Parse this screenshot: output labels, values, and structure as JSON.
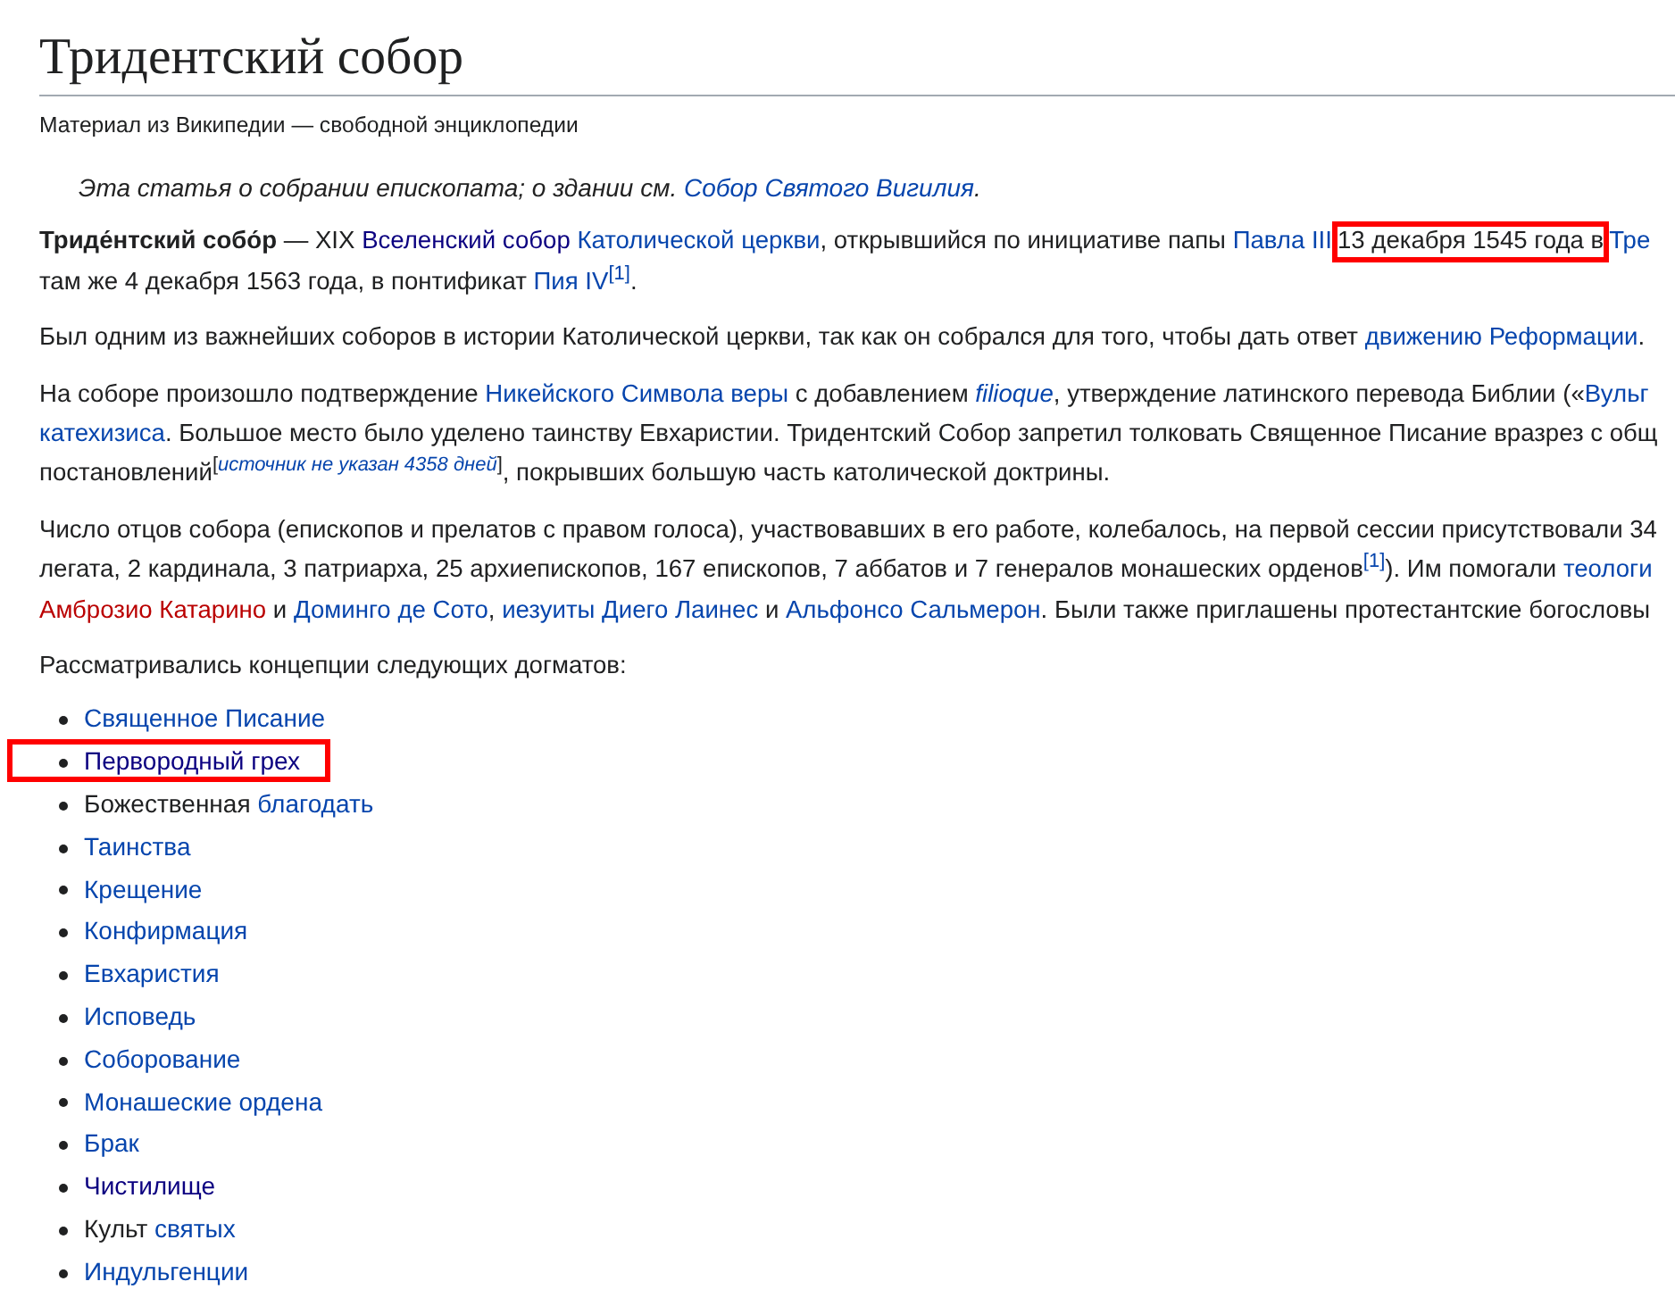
{
  "title": "Тридентский собор",
  "subtitle": "Материал из Википедии — свободной энциклопедии",
  "hatnote": [
    {
      "kind": "text",
      "text": "Эта статья о собрании епископата; о здании см. "
    },
    {
      "kind": "link",
      "text": "Собор Святого Вигилия"
    },
    {
      "kind": "text",
      "text": "."
    }
  ],
  "paragraphs": [
    {
      "lines": [
        [
          {
            "kind": "bold",
            "text": "Триде́нтский собо́р"
          },
          {
            "kind": "text",
            "text": " — XIX "
          },
          {
            "kind": "visited",
            "text": "Вселенский собор "
          },
          {
            "kind": "link",
            "text": "Католической церкви"
          },
          {
            "kind": "text",
            "text": ", открывшийся по инициативе папы "
          },
          {
            "kind": "link",
            "text": "Павла III"
          },
          {
            "kind": "text",
            "text": " 13 декабря 1545 года в ",
            "highlighted": true
          },
          {
            "kind": "link",
            "text": "Тре"
          }
        ],
        [
          {
            "kind": "text",
            "text": "там же 4 декабря 1563 года, в понтификат "
          },
          {
            "kind": "link",
            "text": "Пия IV"
          },
          {
            "kind": "sup",
            "parts": [
              {
                "kind": "link",
                "text": "[1]"
              }
            ]
          },
          {
            "kind": "text",
            "text": "."
          }
        ]
      ]
    },
    {
      "lines": [
        [
          {
            "kind": "text",
            "text": "Был одним из важнейших соборов в истории Католической церкви, так как он собрался для того, чтобы дать ответ "
          },
          {
            "kind": "link",
            "text": "движению Реформации"
          },
          {
            "kind": "text",
            "text": "."
          }
        ]
      ]
    },
    {
      "lines": [
        [
          {
            "kind": "text",
            "text": "На соборе произошло подтверждение "
          },
          {
            "kind": "link",
            "text": "Никейского Символа веры"
          },
          {
            "kind": "text",
            "text": " с добавлением "
          },
          {
            "kind": "italic_link",
            "text": "filioque"
          },
          {
            "kind": "text",
            "text": ", утверждение латинского перевода Библии («"
          },
          {
            "kind": "link",
            "text": "Вульг"
          }
        ],
        [
          {
            "kind": "link",
            "text": "катехизиса"
          },
          {
            "kind": "text",
            "text": ". Большое место было уделено таинству Евхаристии. Тридентский Собор запретил толковать Священное Писание вразрез с общ"
          }
        ],
        [
          {
            "kind": "text",
            "text": "постановлений"
          },
          {
            "kind": "sup",
            "parts": [
              {
                "kind": "text",
                "text": "["
              },
              {
                "kind": "italic_link",
                "text": "источник не указан 4358 дней"
              },
              {
                "kind": "text",
                "text": "]"
              }
            ]
          },
          {
            "kind": "text",
            "text": ", покрывших большую часть католической доктрины."
          }
        ]
      ]
    },
    {
      "lines": [
        [
          {
            "kind": "text",
            "text": "Число отцов собора (епископов и прелатов с правом голоса), участвовавших в его работе, колебалось, на первой сессии присутствовали 34"
          }
        ],
        [
          {
            "kind": "text",
            "text": "легата, 2 кардинала, 3 патриарха, 25 архиепископов, 167 епископов, 7 аббатов и 7 генералов монашеских орденов"
          },
          {
            "kind": "sup",
            "parts": [
              {
                "kind": "link",
                "text": "[1]"
              }
            ]
          },
          {
            "kind": "text",
            "text": "). Им помогали "
          },
          {
            "kind": "link",
            "text": "теологи"
          }
        ],
        [
          {
            "kind": "new",
            "text": "Амброзио Катарино"
          },
          {
            "kind": "text",
            "text": " и "
          },
          {
            "kind": "link",
            "text": "Доминго де Сото"
          },
          {
            "kind": "text",
            "text": ", "
          },
          {
            "kind": "link",
            "text": "иезуиты Диего Лаинес"
          },
          {
            "kind": "text",
            "text": " и "
          },
          {
            "kind": "link",
            "text": "Альфонсо Сальмерон"
          },
          {
            "kind": "text",
            "text": ". Были также приглашены протестантские богословы"
          }
        ]
      ]
    },
    {
      "lines": [
        [
          {
            "kind": "text",
            "text": "Рассматривались концепции следующих догматов:"
          }
        ]
      ]
    }
  ],
  "list": [
    {
      "highlighted": false,
      "parts": [
        {
          "kind": "link",
          "text": "Священное Писание"
        }
      ]
    },
    {
      "highlighted": true,
      "parts": [
        {
          "kind": "visited",
          "text": "Первородный грех"
        }
      ]
    },
    {
      "highlighted": false,
      "parts": [
        {
          "kind": "text",
          "text": "Божественная "
        },
        {
          "kind": "link",
          "text": "благодать"
        }
      ]
    },
    {
      "highlighted": false,
      "parts": [
        {
          "kind": "link",
          "text": "Таинства"
        }
      ]
    },
    {
      "highlighted": false,
      "parts": [
        {
          "kind": "link",
          "text": "Крещение"
        }
      ]
    },
    {
      "highlighted": false,
      "parts": [
        {
          "kind": "link",
          "text": "Конфирмация"
        }
      ]
    },
    {
      "highlighted": false,
      "parts": [
        {
          "kind": "link",
          "text": "Евхаристия"
        }
      ]
    },
    {
      "highlighted": false,
      "parts": [
        {
          "kind": "link",
          "text": "Исповедь"
        }
      ]
    },
    {
      "highlighted": false,
      "parts": [
        {
          "kind": "link",
          "text": "Соборование"
        }
      ]
    },
    {
      "highlighted": false,
      "parts": [
        {
          "kind": "link",
          "text": "Монашеские ордена"
        }
      ]
    },
    {
      "highlighted": false,
      "parts": [
        {
          "kind": "link",
          "text": "Брак"
        }
      ]
    },
    {
      "highlighted": false,
      "parts": [
        {
          "kind": "visited",
          "text": "Чистилище"
        }
      ]
    },
    {
      "highlighted": false,
      "parts": [
        {
          "kind": "text",
          "text": "Культ "
        },
        {
          "kind": "link",
          "text": "святых"
        }
      ]
    },
    {
      "highlighted": false,
      "parts": [
        {
          "kind": "link",
          "text": "Индульгенции"
        }
      ]
    }
  ]
}
